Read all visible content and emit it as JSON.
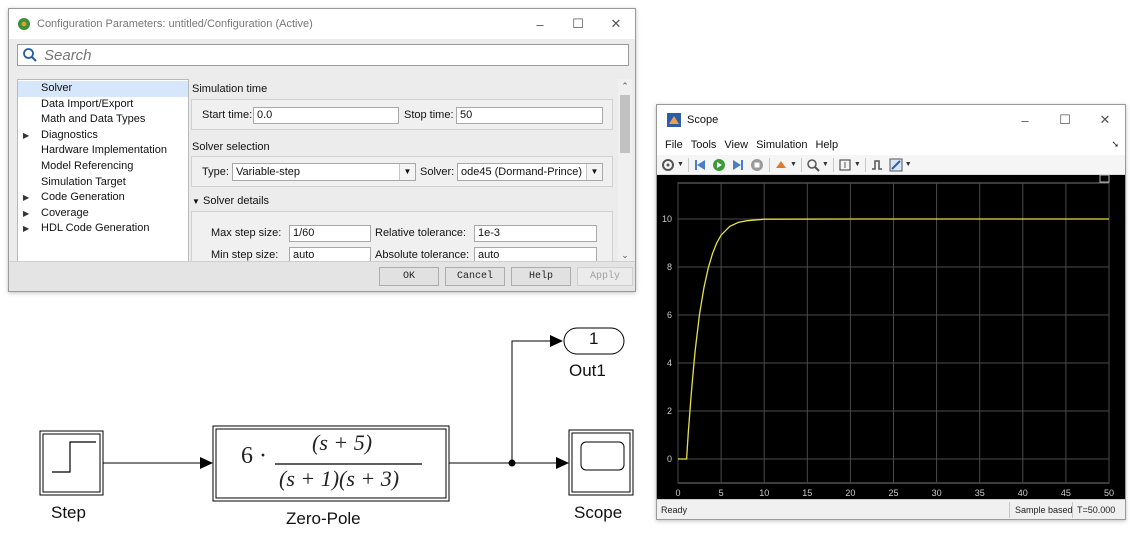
{
  "config_dialog": {
    "title": "Configuration Parameters: untitled/Configuration (Active)",
    "search_placeholder": "Search",
    "tree": [
      {
        "label": "Solver",
        "expandable": false,
        "selected": true
      },
      {
        "label": "Data Import/Export",
        "expandable": false
      },
      {
        "label": "Math and Data Types",
        "expandable": false
      },
      {
        "label": "Diagnostics",
        "expandable": true
      },
      {
        "label": "Hardware Implementation",
        "expandable": false
      },
      {
        "label": "Model Referencing",
        "expandable": false
      },
      {
        "label": "Simulation Target",
        "expandable": false
      },
      {
        "label": "Code Generation",
        "expandable": true
      },
      {
        "label": "Coverage",
        "expandable": true
      },
      {
        "label": "HDL Code Generation",
        "expandable": true
      }
    ],
    "simulation_time": {
      "section_title": "Simulation time",
      "start_label": "Start time:",
      "start_value": "0.0",
      "stop_label": "Stop time:",
      "stop_value": "50"
    },
    "solver_selection": {
      "section_title": "Solver selection",
      "type_label": "Type:",
      "type_value": "Variable-step",
      "solver_label": "Solver:",
      "solver_value": "ode45 (Dormand-Prince)"
    },
    "solver_details": {
      "section_title": "Solver details",
      "max_step_label": "Max step size:",
      "max_step_value": "1/60",
      "min_step_label": "Min step size:",
      "min_step_value": "auto",
      "rel_tol_label": "Relative tolerance:",
      "rel_tol_value": "1e-3",
      "abs_tol_label": "Absolute tolerance:",
      "abs_tol_value": "auto"
    },
    "buttons": {
      "ok": "OK",
      "cancel": "Cancel",
      "help": "Help",
      "apply": "Apply"
    }
  },
  "diagram": {
    "step_label": "Step",
    "zero_pole_label": "Zero-Pole",
    "zero_pole_gain": "6 ·",
    "zero_pole_num": "(s + 5)",
    "zero_pole_den": "(s + 1)(s + 3)",
    "out_port_number": "1",
    "out_label": "Out1",
    "scope_label": "Scope"
  },
  "scope": {
    "title": "Scope",
    "menu": [
      "File",
      "Tools",
      "View",
      "Simulation",
      "Help"
    ],
    "status": {
      "left": "Ready",
      "mode": "Sample based",
      "time": "T=50.000"
    }
  },
  "chart_data": {
    "type": "line",
    "title": "",
    "xlabel": "",
    "ylabel": "",
    "xlim": [
      0,
      50
    ],
    "ylim": [
      -1,
      11.5
    ],
    "xticks": [
      0,
      5,
      10,
      15,
      20,
      25,
      30,
      35,
      40,
      45,
      50
    ],
    "yticks": [
      0,
      2,
      4,
      6,
      8,
      10
    ],
    "grid": true,
    "background": "#000000",
    "grid_color": "#4a4a4a",
    "tick_label_color": "#cccccc",
    "series": [
      {
        "color": "#e6e04a",
        "x": [
          0,
          1,
          1.2,
          1.5,
          1.8,
          2.0,
          2.5,
          3.0,
          3.5,
          4.0,
          4.5,
          5.0,
          6.0,
          7.0,
          8.0,
          10.0,
          20.0,
          30.0,
          40.0,
          50.0
        ],
        "y": [
          0,
          0,
          1.11,
          2.53,
          3.78,
          4.53,
          6.03,
          7.13,
          7.95,
          8.56,
          9.01,
          9.33,
          9.69,
          9.86,
          9.93,
          9.99,
          10.0,
          10.0,
          10.0,
          10.0
        ]
      }
    ]
  }
}
